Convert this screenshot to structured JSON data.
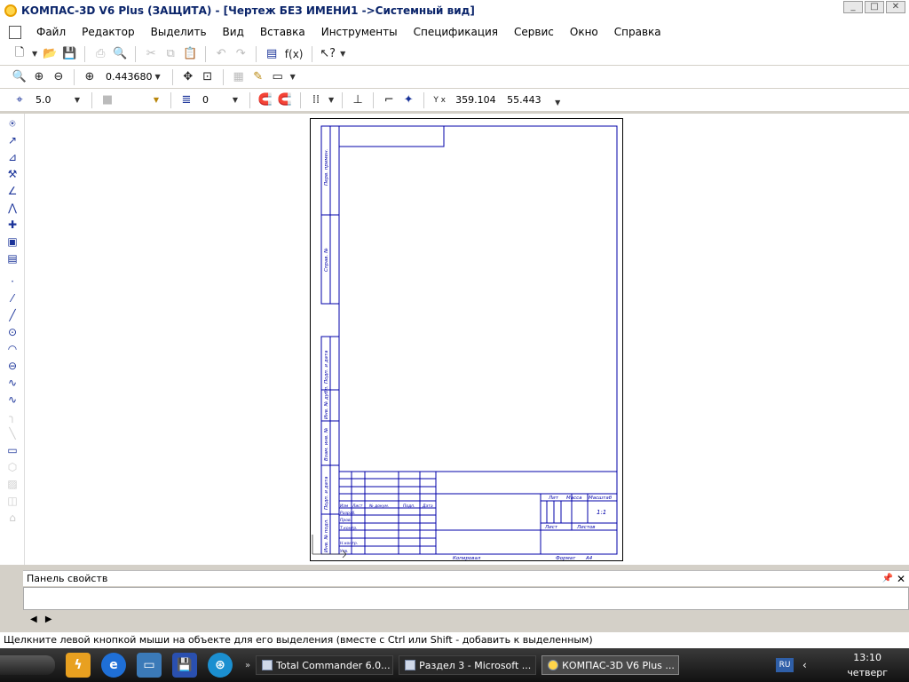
{
  "window": {
    "title": "КОМПАС-3D V6 Plus (ЗАЩИТА) - [Чертеж БЕЗ ИМЕНИ1 ->Системный вид]"
  },
  "menu": [
    "Файл",
    "Редактор",
    "Выделить",
    "Вид",
    "Вставка",
    "Инструменты",
    "Спецификация",
    "Сервис",
    "Окно",
    "Справка"
  ],
  "toolbar": {
    "zoom": "0.443680",
    "fx": "f(x)"
  },
  "toolbar2": {
    "step": "5.0",
    "layer": "0",
    "x_coord": "359.104",
    "y_coord": "55.443"
  },
  "drawing": {
    "side_labels": [
      "Перв. примен.",
      "Справ. №",
      "Подп. и дата",
      "Инв. № дубл.",
      "Взам. инв. №",
      "Подп. и дата",
      "Инв. № подл."
    ],
    "stamp": {
      "lit": "Лит",
      "mass": "Масса",
      "scale": "Масштаб",
      "scale_value": "1:1",
      "sheet": "Лист",
      "sheets": "Листов",
      "izm": "Изм",
      "list_col": "Лист",
      "doc_no": "№ докум.",
      "sign": "Подп.",
      "date": "Дата",
      "razrab": "Разраб.",
      "prov": "Пров.",
      "tkontr": "Т.контр.",
      "nkontr": "Н.контр.",
      "utv": "Утв.",
      "copied": "Копировал",
      "format": "Формат",
      "format_value": "A4"
    }
  },
  "properties_panel": {
    "title": "Панель свойств"
  },
  "status": "Щелкните левой кнопкой мыши на объекте для его выделения (вместе с Ctrl или Shift - добавить к выделенным)",
  "taskbar": {
    "tasks": [
      "Total Commander 6.0...",
      "Раздел 3 - Microsoft ...",
      "КОМПАС-3D V6 Plus ..."
    ],
    "lang": "RU",
    "time": "13:10",
    "day": "четверг"
  }
}
